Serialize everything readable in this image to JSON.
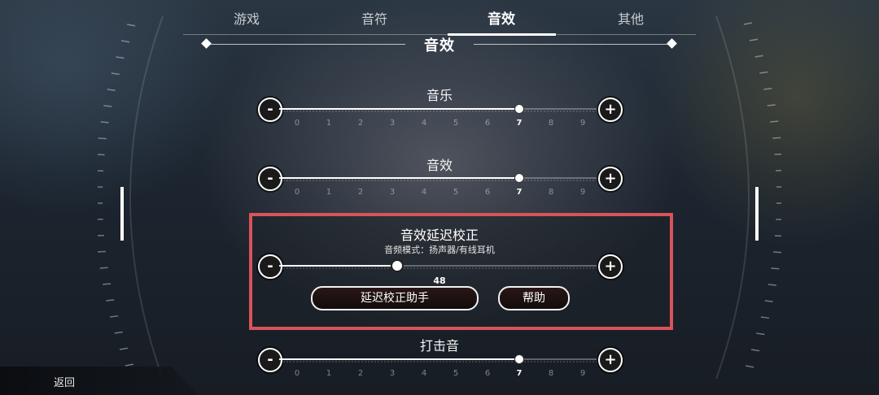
{
  "tabs": [
    {
      "label": "游戏"
    },
    {
      "label": "音符"
    },
    {
      "label": "音效"
    },
    {
      "label": "其他"
    }
  ],
  "active_tab": "音效",
  "section_title": "音效",
  "sliders": [
    {
      "label": "音乐",
      "value": 7,
      "min": 0,
      "max": 9,
      "ticks": [
        "0",
        "1",
        "2",
        "3",
        "4",
        "5",
        "6",
        "7",
        "8",
        "9"
      ]
    },
    {
      "label": "音效",
      "value": 7,
      "min": 0,
      "max": 9,
      "ticks": [
        "0",
        "1",
        "2",
        "3",
        "4",
        "5",
        "6",
        "7",
        "8",
        "9"
      ]
    },
    {
      "label": "打击音",
      "value": 7,
      "min": 0,
      "max": 9,
      "ticks": [
        "0",
        "1",
        "2",
        "3",
        "4",
        "5",
        "6",
        "7",
        "8",
        "9"
      ]
    }
  ],
  "delay": {
    "title": "音效延迟校正",
    "mode": "音频模式：扬声器/有线耳机",
    "value": "48",
    "position_fraction": 0.37,
    "assistant_button": "延迟校正助手",
    "help_button": "帮助"
  },
  "buttons": {
    "minus": "-",
    "plus": "+"
  },
  "back_label": "返回",
  "colors": {
    "highlight_border": "#d9535a",
    "accent": "#ffffff"
  }
}
